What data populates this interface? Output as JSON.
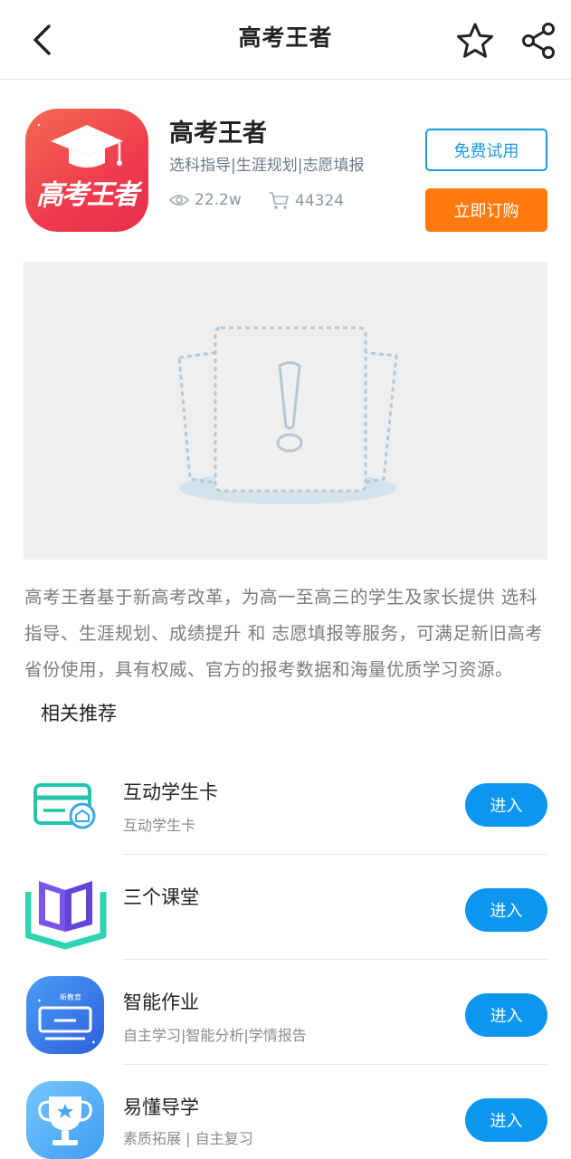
{
  "header": {
    "title": "高考王者"
  },
  "app": {
    "name": "高考王者",
    "logo_text": "高考王者",
    "tags": "选科指导|生涯规划|志愿填报",
    "views": "22.2w",
    "purchases": "44324",
    "trial_label": "免费试用",
    "buy_label": "立即订购"
  },
  "description": "高考王者基于新高考改革，为高一至高三的学生及家长提供 选科指导、生涯规划、成绩提升 和 志愿填报等服务，可满足新旧高考省份使用，具有权威、官方的报考数据和海量优质学习资源。",
  "recommend": {
    "title": "相关推荐",
    "items": [
      {
        "name": "互动学生卡",
        "sub": "互动学生卡",
        "button": "进入",
        "icon": "student-card-icon"
      },
      {
        "name": "三个课堂",
        "sub": "",
        "button": "进入",
        "icon": "open-book-icon"
      },
      {
        "name": "智能作业",
        "sub": "自主学习|智能分析|学情报告",
        "button": "进入",
        "icon": "smart-homework-icon",
        "icon_badge": "新教育"
      },
      {
        "name": "易懂导学",
        "sub": "素质拓展 | 自主复习",
        "button": "进入",
        "icon": "trophy-icon"
      }
    ]
  },
  "colors": {
    "accent_blue": "#0d96ee",
    "buy_orange": "#ff7a0e",
    "logo_red": "#ef3b4d"
  }
}
